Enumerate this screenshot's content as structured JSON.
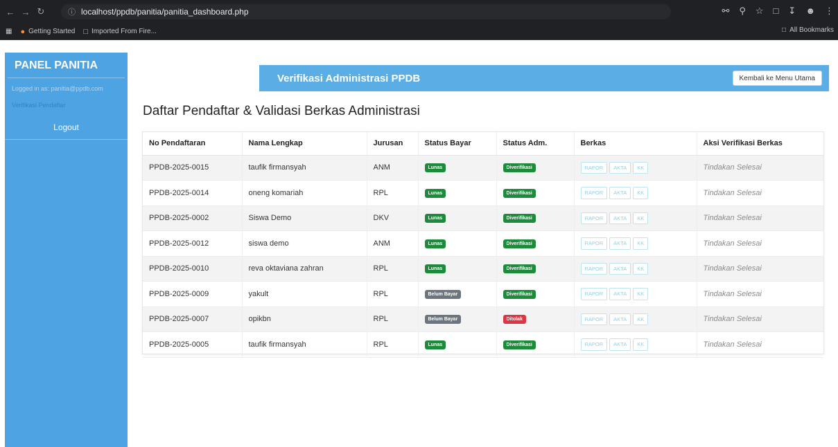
{
  "browser": {
    "url": "localhost/ppdb/panitia/panitia_dashboard.php",
    "bookmarks": [
      "Getting Started",
      "Imported From Fire..."
    ],
    "all_bookmarks": "All Bookmarks"
  },
  "sidebar": {
    "title": "PANEL PANITIA",
    "logged_in": "Logged in as: panitia@ppdb.com",
    "active_item": "Verifikasi Pendaftar",
    "logout": "Logout"
  },
  "header": {
    "title": "Verifikasi Administrasi PPDB",
    "back_button": "Kembali ke Menu Utama"
  },
  "page_title": "Daftar Pendaftar & Validasi Berkas Administrasi",
  "table": {
    "columns": [
      "No Pendaftaran",
      "Nama Lengkap",
      "Jurusan",
      "Status Bayar",
      "Status Adm.",
      "Berkas",
      "Aksi Verifikasi Berkas"
    ],
    "file_labels": [
      "RAPOR",
      "AKTA",
      "KK"
    ],
    "rows": [
      {
        "no": "PPDB-2025-0015",
        "nama": "taufik firmansyah",
        "jurusan": "ANM",
        "bayar": "Lunas",
        "adm": "Diverifikasi",
        "aksi": "Tindakan Selesai"
      },
      {
        "no": "PPDB-2025-0014",
        "nama": "oneng komariah",
        "jurusan": "RPL",
        "bayar": "Lunas",
        "adm": "Diverifikasi",
        "aksi": "Tindakan Selesai"
      },
      {
        "no": "PPDB-2025-0002",
        "nama": "Siswa Demo",
        "jurusan": "DKV",
        "bayar": "Lunas",
        "adm": "Diverifikasi",
        "aksi": "Tindakan Selesai"
      },
      {
        "no": "PPDB-2025-0012",
        "nama": "siswa demo",
        "jurusan": "ANM",
        "bayar": "Lunas",
        "adm": "Diverifikasi",
        "aksi": "Tindakan Selesai"
      },
      {
        "no": "PPDB-2025-0010",
        "nama": "reva oktaviana zahran",
        "jurusan": "RPL",
        "bayar": "Lunas",
        "adm": "Diverifikasi",
        "aksi": "Tindakan Selesai"
      },
      {
        "no": "PPDB-2025-0009",
        "nama": "yakult",
        "jurusan": "RPL",
        "bayar": "Belum Bayar",
        "adm": "Diverifikasi",
        "aksi": "Tindakan Selesai"
      },
      {
        "no": "PPDB-2025-0007",
        "nama": "opikbn",
        "jurusan": "RPL",
        "bayar": "Belum Bayar",
        "adm": "Ditolak",
        "aksi": "Tindakan Selesai"
      },
      {
        "no": "PPDB-2025-0005",
        "nama": "taufik firmansyah",
        "jurusan": "RPL",
        "bayar": "Lunas",
        "adm": "Diverifikasi",
        "aksi": "Tindakan Selesai"
      }
    ]
  },
  "colors": {
    "sidebar": "#4ea3e3",
    "header": "#5aaee5",
    "lunas": "#1e8a3c",
    "belum_bayar": "#6c757d",
    "ditolak": "#dc3545"
  }
}
